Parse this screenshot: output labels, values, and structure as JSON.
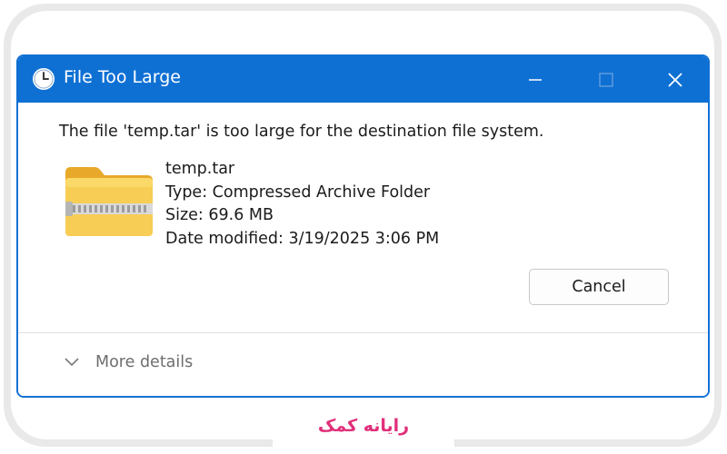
{
  "dialog": {
    "title": "File Too Large",
    "message": "The file 'temp.tar' is too large for the destination file system.",
    "file": {
      "name": "temp.tar",
      "type": "Type: Compressed Archive Folder",
      "size": "Size: 69.6 MB",
      "date_modified": "Date modified: 3/19/2025 3:06 PM"
    },
    "cancel_label": "Cancel",
    "more_details_label": "More details",
    "titlebar_icon": "clock-icon",
    "file_icon": "zip-folder-icon"
  },
  "window_controls": {
    "minimize_icon": "minimize-icon",
    "maximize_icon": "maximize-icon",
    "close_icon": "close-icon"
  },
  "brand": {
    "text": "رایانه کمک"
  },
  "colors": {
    "titlebar": "#0f70d4",
    "brand": "#e0307a",
    "folder": "#f5c542"
  }
}
